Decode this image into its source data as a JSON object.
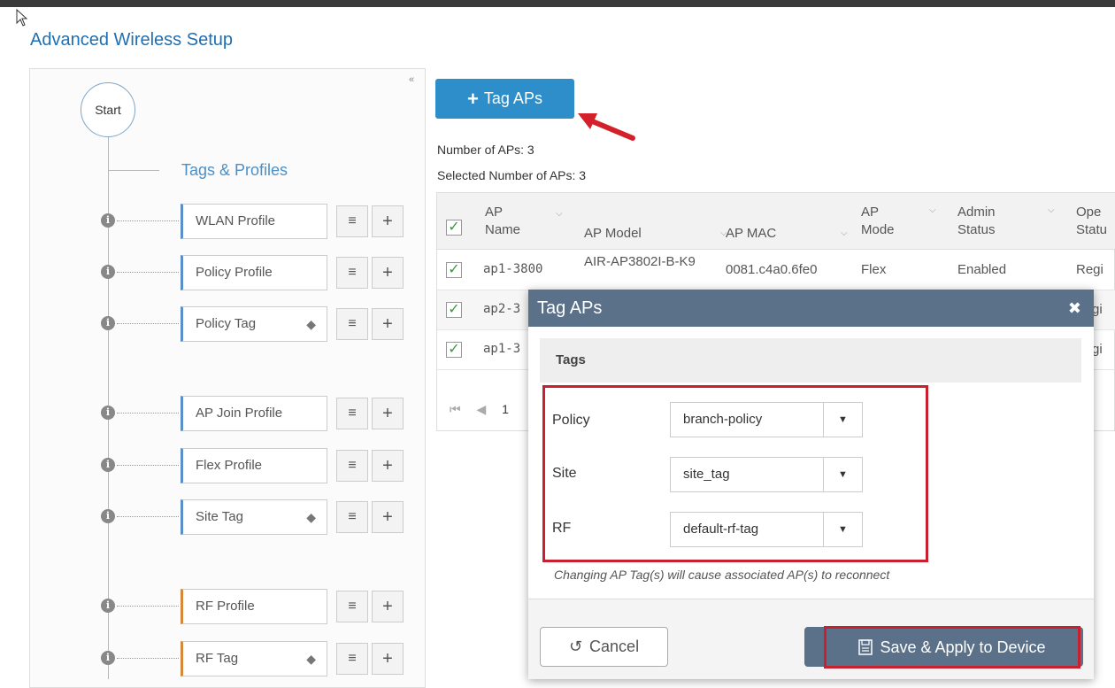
{
  "page": {
    "title": "Advanced Wireless Setup"
  },
  "left_panel": {
    "start_label": "Start",
    "tags_heading": "Tags & Profiles",
    "profiles": [
      {
        "label": "WLAN Profile",
        "tag": false
      },
      {
        "label": "Policy Profile",
        "tag": false
      },
      {
        "label": "Policy Tag",
        "tag": true
      },
      {
        "label": "AP Join Profile",
        "tag": false
      },
      {
        "label": "Flex Profile",
        "tag": false
      },
      {
        "label": "Site Tag",
        "tag": true
      },
      {
        "label": "RF Profile",
        "tag": false
      },
      {
        "label": "RF Tag",
        "tag": true
      }
    ]
  },
  "toolbar": {
    "tag_aps_label": "Tag APs",
    "number_of_aps": "Number of APs: 3",
    "selected_number_of_aps": "Selected Number of APs: 3"
  },
  "ap_table": {
    "columns": [
      "AP Name",
      "AP Model",
      "AP MAC",
      "AP Mode",
      "Admin Status",
      "Ope Statu"
    ],
    "rows": [
      {
        "name": "ap1-3800",
        "model": "AIR-AP3802I-B-K9",
        "mac": "0081.c4a0.6fe0",
        "mode": "Flex",
        "admin": "Enabled",
        "oper": "Regi"
      },
      {
        "name": "ap2-3",
        "oper": "gi"
      },
      {
        "name": "ap1-3",
        "oper": "gi"
      }
    ],
    "pager_page": "1"
  },
  "modal": {
    "title": "Tag APs",
    "section": "Tags",
    "fields": [
      {
        "label": "Policy",
        "value": "branch-policy"
      },
      {
        "label": "Site",
        "value": "site_tag"
      },
      {
        "label": "RF",
        "value": "default-rf-tag"
      }
    ],
    "warning": "Changing AP Tag(s) will cause associated AP(s) to reconnect",
    "cancel_label": "Cancel",
    "save_label": "Save & Apply to Device"
  },
  "colors": {
    "accent": "#2d8ec9",
    "modal_header": "#5a7189",
    "highlight": "#c8202f",
    "checkbox": "#3a9a3a"
  }
}
